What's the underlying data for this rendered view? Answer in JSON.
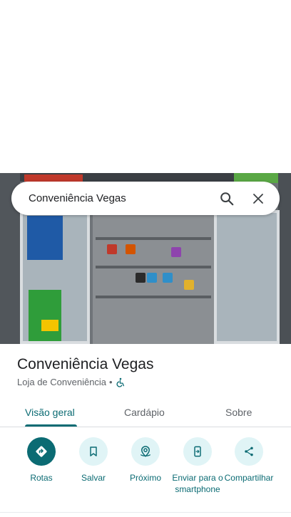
{
  "search": {
    "query": "Conveniência Vegas"
  },
  "place": {
    "name": "Conveniência Vegas",
    "category": "Loja de Conveniência",
    "separator": "•"
  },
  "tabs": [
    {
      "label": "Visão geral",
      "active": true
    },
    {
      "label": "Cardápio",
      "active": false
    },
    {
      "label": "Sobre",
      "active": false
    }
  ],
  "actions": [
    {
      "label": "Rotas",
      "icon": "directions-icon"
    },
    {
      "label": "Salvar",
      "icon": "bookmark-icon"
    },
    {
      "label": "Próximo",
      "icon": "nearby-icon"
    },
    {
      "label": "Enviar para o smartphone",
      "icon": "send-to-phone-icon"
    },
    {
      "label": "Compartilhar",
      "icon": "share-icon"
    }
  ],
  "colors": {
    "accent": "#0b6b73",
    "action_bg": "#e0f4f6",
    "text_primary": "#202124",
    "text_secondary": "#5f6368"
  }
}
